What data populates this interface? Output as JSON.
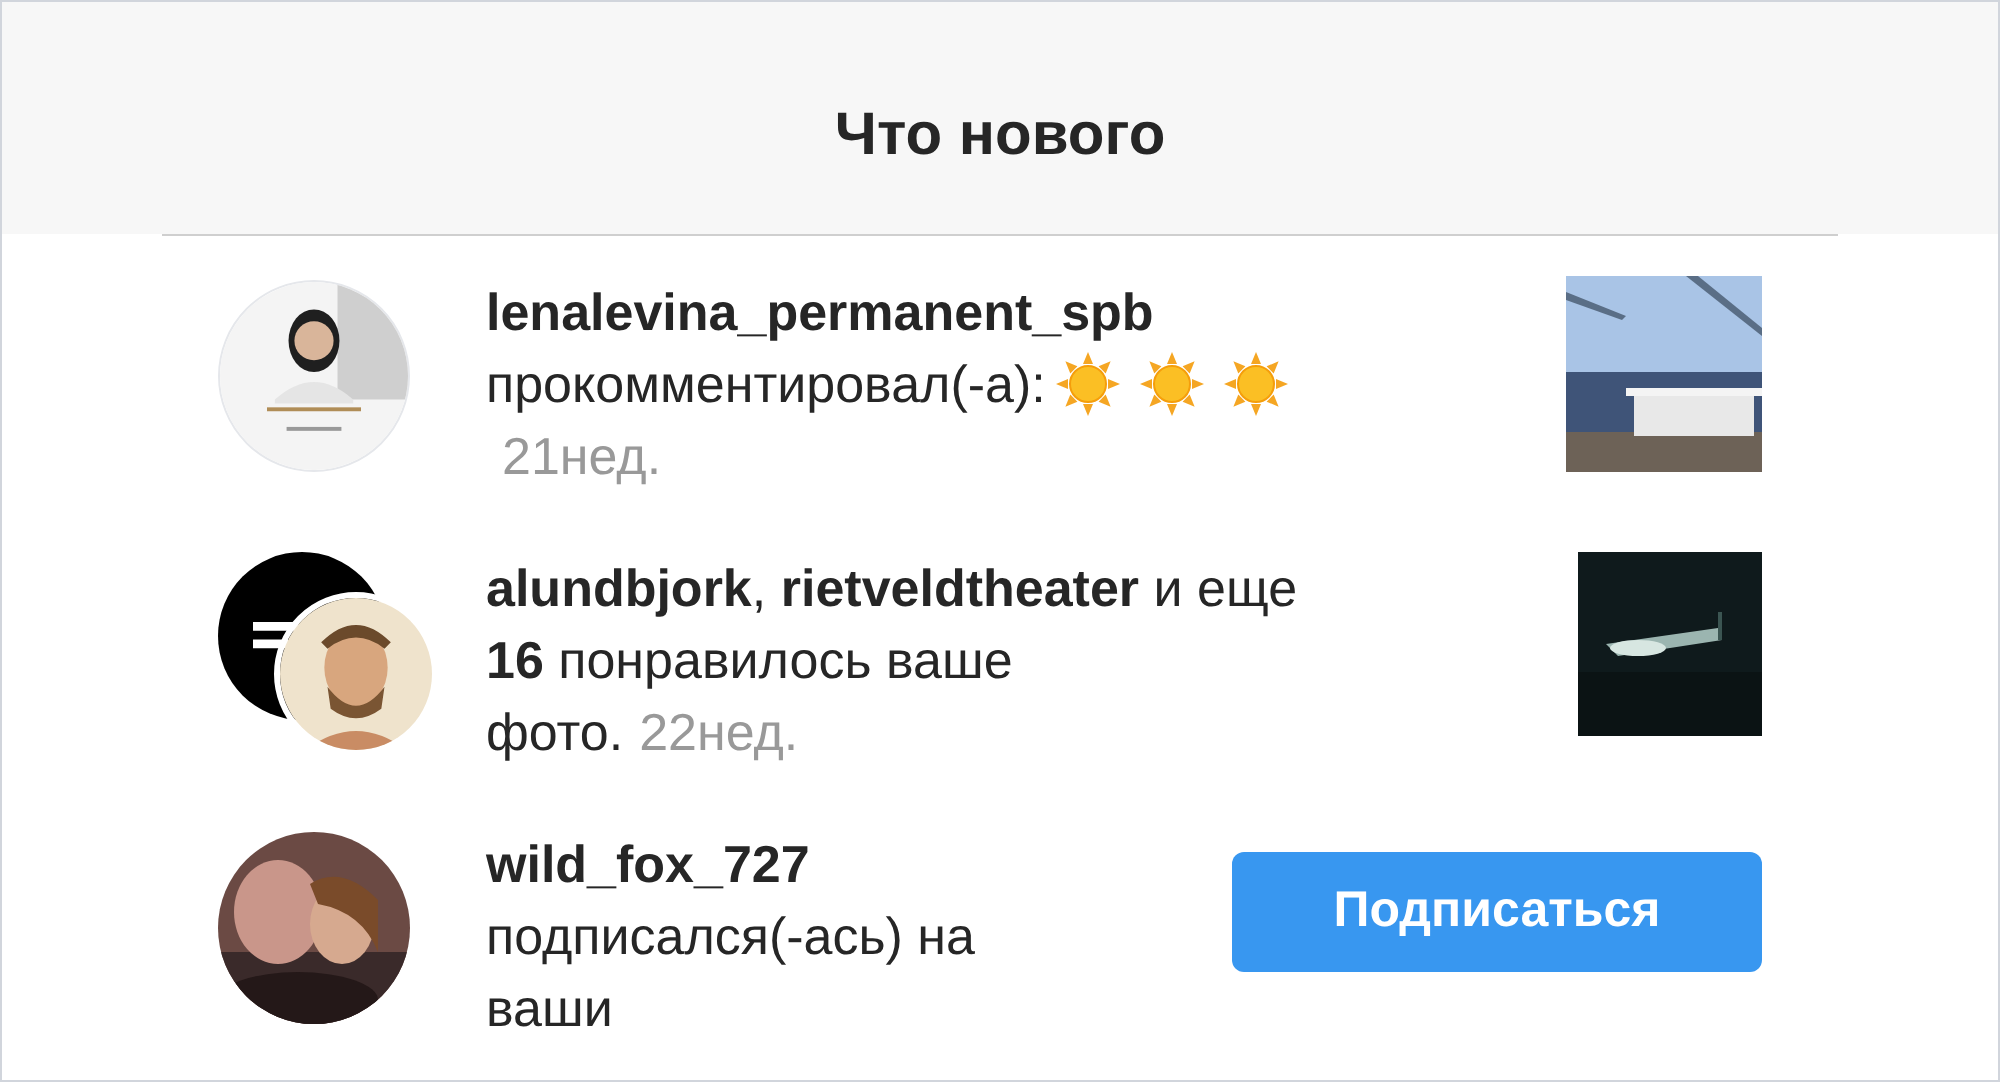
{
  "header": {
    "title": "Что нового"
  },
  "notifications": [
    {
      "avatar": {
        "kind": "single"
      },
      "user": "lenalevina_permanent_spb",
      "text": "прокомментировал(-а):",
      "emojis": [
        {
          "kind": "sun"
        },
        {
          "kind": "sun"
        },
        {
          "kind": "sun"
        }
      ],
      "time": "21нед.",
      "action": {
        "kind": "thumbnail"
      }
    },
    {
      "avatar": {
        "kind": "stacked"
      },
      "text": "**alundbjork**, **rietveldtheater** и еще **16** понравилось ваше фото.",
      "time": "22нед.",
      "action": {
        "kind": "thumbnail"
      }
    },
    {
      "avatar": {
        "kind": "single"
      },
      "user": "wild_fox_727",
      "text": "подписался(-ась) на ваши",
      "action": {
        "kind": "follow",
        "label": "Подписаться"
      }
    }
  ]
}
